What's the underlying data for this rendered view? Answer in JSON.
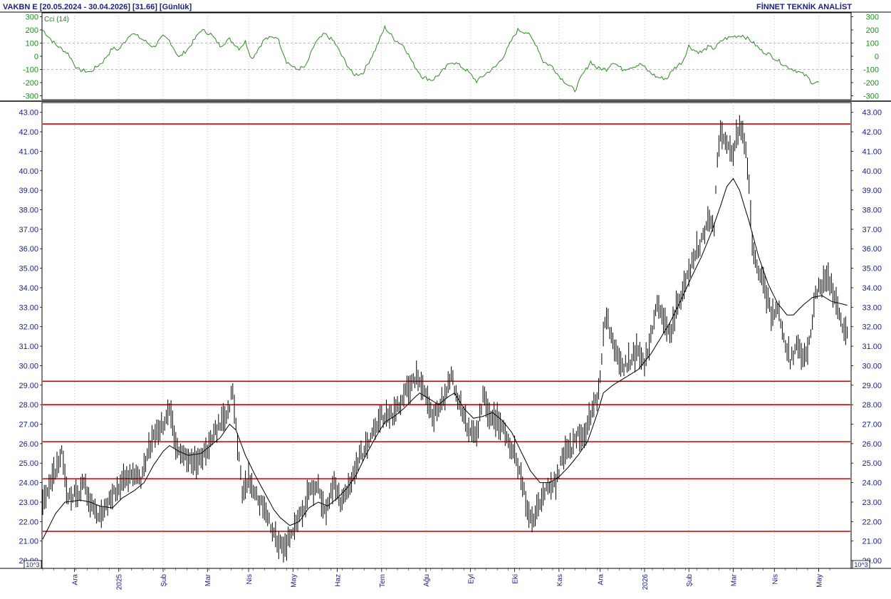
{
  "header": {
    "symbol_range": "VAKBN E  [20.05.2024 - 30.04.2026]  [31.66]  [Günlük]",
    "brand": "FİNNET TEKNİK ANALİST"
  },
  "colors": {
    "price": "#000000",
    "moving_average": "#000000",
    "cci": "#2e8b22",
    "hlines": "#cc0000",
    "axis_text": "#1a237e",
    "grid": "#9e9e9e"
  },
  "chart_data": [
    {
      "type": "line",
      "title": "Cci (14)",
      "ylim": [
        -330,
        330
      ],
      "yticks": [
        300,
        200,
        100,
        0,
        -100,
        -200,
        -300
      ],
      "ytick_labels": [
        "300",
        "200",
        "100",
        "0",
        "-100",
        "-200",
        "-300"
      ],
      "reference_lines": [
        100,
        -100
      ],
      "x_index_range": [
        0,
        490
      ],
      "anchors": [
        [
          0,
          200
        ],
        [
          8,
          90
        ],
        [
          16,
          20
        ],
        [
          22,
          -100
        ],
        [
          30,
          -120
        ],
        [
          38,
          -40
        ],
        [
          44,
          60
        ],
        [
          48,
          50
        ],
        [
          56,
          180
        ],
        [
          64,
          120
        ],
        [
          70,
          70
        ],
        [
          76,
          150
        ],
        [
          80,
          120
        ],
        [
          86,
          -10
        ],
        [
          92,
          60
        ],
        [
          100,
          200
        ],
        [
          106,
          170
        ],
        [
          112,
          80
        ],
        [
          118,
          130
        ],
        [
          124,
          60
        ],
        [
          128,
          110
        ],
        [
          132,
          -20
        ],
        [
          140,
          130
        ],
        [
          148,
          150
        ],
        [
          154,
          -40
        ],
        [
          160,
          -100
        ],
        [
          166,
          -80
        ],
        [
          172,
          100
        ],
        [
          178,
          170
        ],
        [
          184,
          110
        ],
        [
          190,
          -20
        ],
        [
          196,
          -140
        ],
        [
          202,
          -130
        ],
        [
          210,
          50
        ],
        [
          216,
          220
        ],
        [
          222,
          130
        ],
        [
          228,
          80
        ],
        [
          234,
          -60
        ],
        [
          240,
          -160
        ],
        [
          246,
          -180
        ],
        [
          252,
          -120
        ],
        [
          258,
          -40
        ],
        [
          262,
          -60
        ],
        [
          268,
          -110
        ],
        [
          274,
          -190
        ],
        [
          280,
          -130
        ],
        [
          286,
          -80
        ],
        [
          292,
          20
        ],
        [
          296,
          120
        ],
        [
          300,
          200
        ],
        [
          306,
          180
        ],
        [
          312,
          80
        ],
        [
          316,
          -40
        ],
        [
          322,
          -80
        ],
        [
          326,
          -150
        ],
        [
          332,
          -220
        ],
        [
          336,
          -260
        ],
        [
          340,
          -160
        ],
        [
          346,
          -40
        ],
        [
          350,
          -90
        ],
        [
          356,
          -100
        ],
        [
          360,
          -40
        ],
        [
          366,
          -100
        ],
        [
          372,
          -80
        ],
        [
          378,
          -60
        ],
        [
          382,
          -110
        ],
        [
          388,
          -160
        ],
        [
          394,
          -170
        ],
        [
          398,
          -100
        ],
        [
          404,
          -40
        ],
        [
          408,
          80
        ],
        [
          412,
          40
        ],
        [
          416,
          30
        ],
        [
          420,
          70
        ],
        [
          424,
          60
        ],
        [
          430,
          130
        ],
        [
          436,
          150
        ],
        [
          442,
          160
        ],
        [
          448,
          110
        ],
        [
          454,
          40
        ],
        [
          458,
          20
        ],
        [
          464,
          -30
        ],
        [
          470,
          -80
        ],
        [
          476,
          -110
        ],
        [
          482,
          -150
        ],
        [
          486,
          -200
        ],
        [
          490,
          -200
        ]
      ]
    },
    {
      "type": "line",
      "ylim": [
        20.0,
        43.0
      ],
      "yticks": [
        20,
        21,
        22,
        23,
        24,
        25,
        26,
        27,
        28,
        29,
        30,
        31,
        32,
        33,
        34,
        35,
        36,
        37,
        38,
        39,
        40,
        41,
        42,
        43
      ],
      "ytick_labels": [
        "20.00",
        "21.00",
        "22.00",
        "23.00",
        "24.00",
        "25.00",
        "26.00",
        "27.00",
        "28.00",
        "29.00",
        "30.00",
        "31.00",
        "32.00",
        "33.00",
        "34.00",
        "35.00",
        "36.00",
        "37.00",
        "38.00",
        "39.00",
        "40.00",
        "41.00",
        "42.00",
        "43.00"
      ],
      "hlines": [
        42.4,
        29.2,
        28.0,
        26.1,
        24.2,
        21.5
      ],
      "x_axis_months": [
        {
          "label": "Ara",
          "index": 20
        },
        {
          "label": "2025",
          "index": 48
        },
        {
          "label": "Şub",
          "index": 76
        },
        {
          "label": "Mar",
          "index": 104
        },
        {
          "label": "Nis",
          "index": 130
        },
        {
          "label": "May",
          "index": 158
        },
        {
          "label": "Haz",
          "index": 186
        },
        {
          "label": "Tem",
          "index": 214
        },
        {
          "label": "Ağu",
          "index": 242
        },
        {
          "label": "Eyl",
          "index": 270
        },
        {
          "label": "Eki",
          "index": 298
        },
        {
          "label": "Kas",
          "index": 326
        },
        {
          "label": "Ara",
          "index": 352
        },
        {
          "label": "2026",
          "index": 380
        },
        {
          "label": "Şub",
          "index": 408
        },
        {
          "label": "Mar",
          "index": 436
        },
        {
          "label": "Nis",
          "index": 462
        },
        {
          "label": "May",
          "index": 490
        }
      ],
      "x_index_range": [
        0,
        490
      ],
      "unit_label": "10^3",
      "price_anchors": [
        [
          0,
          22.8
        ],
        [
          8,
          24.6
        ],
        [
          12,
          25.6
        ],
        [
          16,
          23.2
        ],
        [
          22,
          23.4
        ],
        [
          26,
          24.0
        ],
        [
          30,
          22.8
        ],
        [
          36,
          22.4
        ],
        [
          44,
          23.3
        ],
        [
          50,
          24.1
        ],
        [
          58,
          24.3
        ],
        [
          62,
          24.2
        ],
        [
          66,
          25.5
        ],
        [
          70,
          26.4
        ],
        [
          76,
          27.0
        ],
        [
          80,
          27.8
        ],
        [
          84,
          26.0
        ],
        [
          90,
          25.3
        ],
        [
          96,
          25.1
        ],
        [
          100,
          25.2
        ],
        [
          104,
          25.8
        ],
        [
          108,
          26.5
        ],
        [
          114,
          27.2
        ],
        [
          118,
          28.0
        ],
        [
          120,
          28.9
        ],
        [
          123,
          26.0
        ],
        [
          126,
          23.6
        ],
        [
          130,
          24.2
        ],
        [
          136,
          23.2
        ],
        [
          142,
          22.2
        ],
        [
          148,
          21.0
        ],
        [
          152,
          20.6
        ],
        [
          158,
          21.4
        ],
        [
          164,
          22.5
        ],
        [
          168,
          23.4
        ],
        [
          174,
          23.8
        ],
        [
          178,
          22.4
        ],
        [
          184,
          24.0
        ],
        [
          188,
          23.0
        ],
        [
          192,
          23.4
        ],
        [
          196,
          24.4
        ],
        [
          200,
          25.3
        ],
        [
          204,
          25.8
        ],
        [
          208,
          26.5
        ],
        [
          212,
          27.3
        ],
        [
          218,
          27.4
        ],
        [
          222,
          27.5
        ],
        [
          226,
          28.2
        ],
        [
          230,
          28.8
        ],
        [
          236,
          29.4
        ],
        [
          242,
          28.6
        ],
        [
          246,
          27.4
        ],
        [
          250,
          27.6
        ],
        [
          254,
          28.6
        ],
        [
          258,
          29.4
        ],
        [
          262,
          28.4
        ],
        [
          266,
          27.3
        ],
        [
          270,
          26.5
        ],
        [
          274,
          26.4
        ],
        [
          278,
          28.4
        ],
        [
          282,
          27.6
        ],
        [
          286,
          27.2
        ],
        [
          290,
          27.0
        ],
        [
          294,
          26.1
        ],
        [
          298,
          25.6
        ],
        [
          302,
          24.3
        ],
        [
          306,
          22.7
        ],
        [
          310,
          22.0
        ],
        [
          314,
          23.1
        ],
        [
          318,
          23.7
        ],
        [
          324,
          24.0
        ],
        [
          328,
          25.3
        ],
        [
          334,
          25.8
        ],
        [
          338,
          26.4
        ],
        [
          342,
          26.4
        ],
        [
          346,
          27.5
        ],
        [
          350,
          28.4
        ],
        [
          352,
          29.6
        ],
        [
          354,
          31.5
        ],
        [
          356,
          32.6
        ],
        [
          360,
          31.2
        ],
        [
          366,
          29.8
        ],
        [
          372,
          30.4
        ],
        [
          376,
          30.8
        ],
        [
          380,
          30.0
        ],
        [
          384,
          31.4
        ],
        [
          388,
          33.2
        ],
        [
          392,
          32.3
        ],
        [
          396,
          31.5
        ],
        [
          400,
          32.9
        ],
        [
          404,
          33.6
        ],
        [
          408,
          34.8
        ],
        [
          412,
          35.8
        ],
        [
          416,
          36.4
        ],
        [
          420,
          37.3
        ],
        [
          424,
          37.0
        ],
        [
          426,
          40.8
        ],
        [
          428,
          42.0
        ],
        [
          432,
          41.2
        ],
        [
          436,
          41.0
        ],
        [
          440,
          42.3
        ],
        [
          444,
          41.2
        ],
        [
          446,
          39.5
        ],
        [
          448,
          36.2
        ],
        [
          452,
          35.0
        ],
        [
          456,
          34.0
        ],
        [
          460,
          32.6
        ],
        [
          464,
          33.0
        ],
        [
          468,
          31.5
        ],
        [
          472,
          30.3
        ],
        [
          476,
          31.0
        ],
        [
          480,
          30.3
        ],
        [
          484,
          31.2
        ],
        [
          488,
          33.6
        ],
        [
          492,
          34.2
        ],
        [
          496,
          34.6
        ],
        [
          500,
          33.4
        ],
        [
          504,
          32.3
        ],
        [
          508,
          31.66
        ]
      ],
      "ma_anchors": [
        [
          0,
          21.1
        ],
        [
          8,
          22.4
        ],
        [
          14,
          23.0
        ],
        [
          24,
          23.1
        ],
        [
          30,
          23.0
        ],
        [
          36,
          22.8
        ],
        [
          44,
          22.7
        ],
        [
          50,
          23.2
        ],
        [
          58,
          23.6
        ],
        [
          64,
          24.0
        ],
        [
          70,
          24.9
        ],
        [
          76,
          25.6
        ],
        [
          80,
          25.9
        ],
        [
          86,
          25.6
        ],
        [
          92,
          25.4
        ],
        [
          100,
          25.5
        ],
        [
          106,
          25.9
        ],
        [
          112,
          26.3
        ],
        [
          118,
          27.0
        ],
        [
          122,
          26.7
        ],
        [
          128,
          25.4
        ],
        [
          134,
          24.4
        ],
        [
          140,
          23.5
        ],
        [
          146,
          22.6
        ],
        [
          150,
          22.2
        ],
        [
          156,
          21.8
        ],
        [
          162,
          22.0
        ],
        [
          168,
          22.7
        ],
        [
          174,
          23.0
        ],
        [
          180,
          22.8
        ],
        [
          186,
          23.2
        ],
        [
          192,
          23.7
        ],
        [
          198,
          24.4
        ],
        [
          204,
          25.4
        ],
        [
          210,
          26.3
        ],
        [
          216,
          27.1
        ],
        [
          222,
          27.4
        ],
        [
          228,
          27.8
        ],
        [
          234,
          28.3
        ],
        [
          238,
          28.6
        ],
        [
          244,
          28.3
        ],
        [
          250,
          28.0
        ],
        [
          256,
          28.4
        ],
        [
          260,
          28.6
        ],
        [
          266,
          27.8
        ],
        [
          272,
          27.3
        ],
        [
          278,
          27.4
        ],
        [
          284,
          27.6
        ],
        [
          290,
          27.2
        ],
        [
          296,
          26.6
        ],
        [
          302,
          25.6
        ],
        [
          308,
          24.6
        ],
        [
          314,
          24.0
        ],
        [
          320,
          24.0
        ],
        [
          326,
          24.3
        ],
        [
          332,
          24.8
        ],
        [
          338,
          25.4
        ],
        [
          344,
          26.1
        ],
        [
          350,
          27.5
        ],
        [
          354,
          28.6
        ],
        [
          360,
          29.0
        ],
        [
          368,
          29.4
        ],
        [
          376,
          29.8
        ],
        [
          384,
          30.6
        ],
        [
          390,
          31.4
        ],
        [
          396,
          32.2
        ],
        [
          402,
          33.2
        ],
        [
          410,
          34.6
        ],
        [
          416,
          35.6
        ],
        [
          422,
          36.8
        ],
        [
          428,
          38.2
        ],
        [
          432,
          39.2
        ],
        [
          436,
          39.6
        ],
        [
          440,
          39.0
        ],
        [
          446,
          37.4
        ],
        [
          452,
          35.6
        ],
        [
          458,
          34.2
        ],
        [
          464,
          33.2
        ],
        [
          470,
          32.6
        ],
        [
          474,
          32.6
        ],
        [
          480,
          33.1
        ],
        [
          486,
          33.5
        ],
        [
          492,
          33.6
        ],
        [
          498,
          33.3
        ],
        [
          508,
          33.1
        ]
      ]
    }
  ]
}
